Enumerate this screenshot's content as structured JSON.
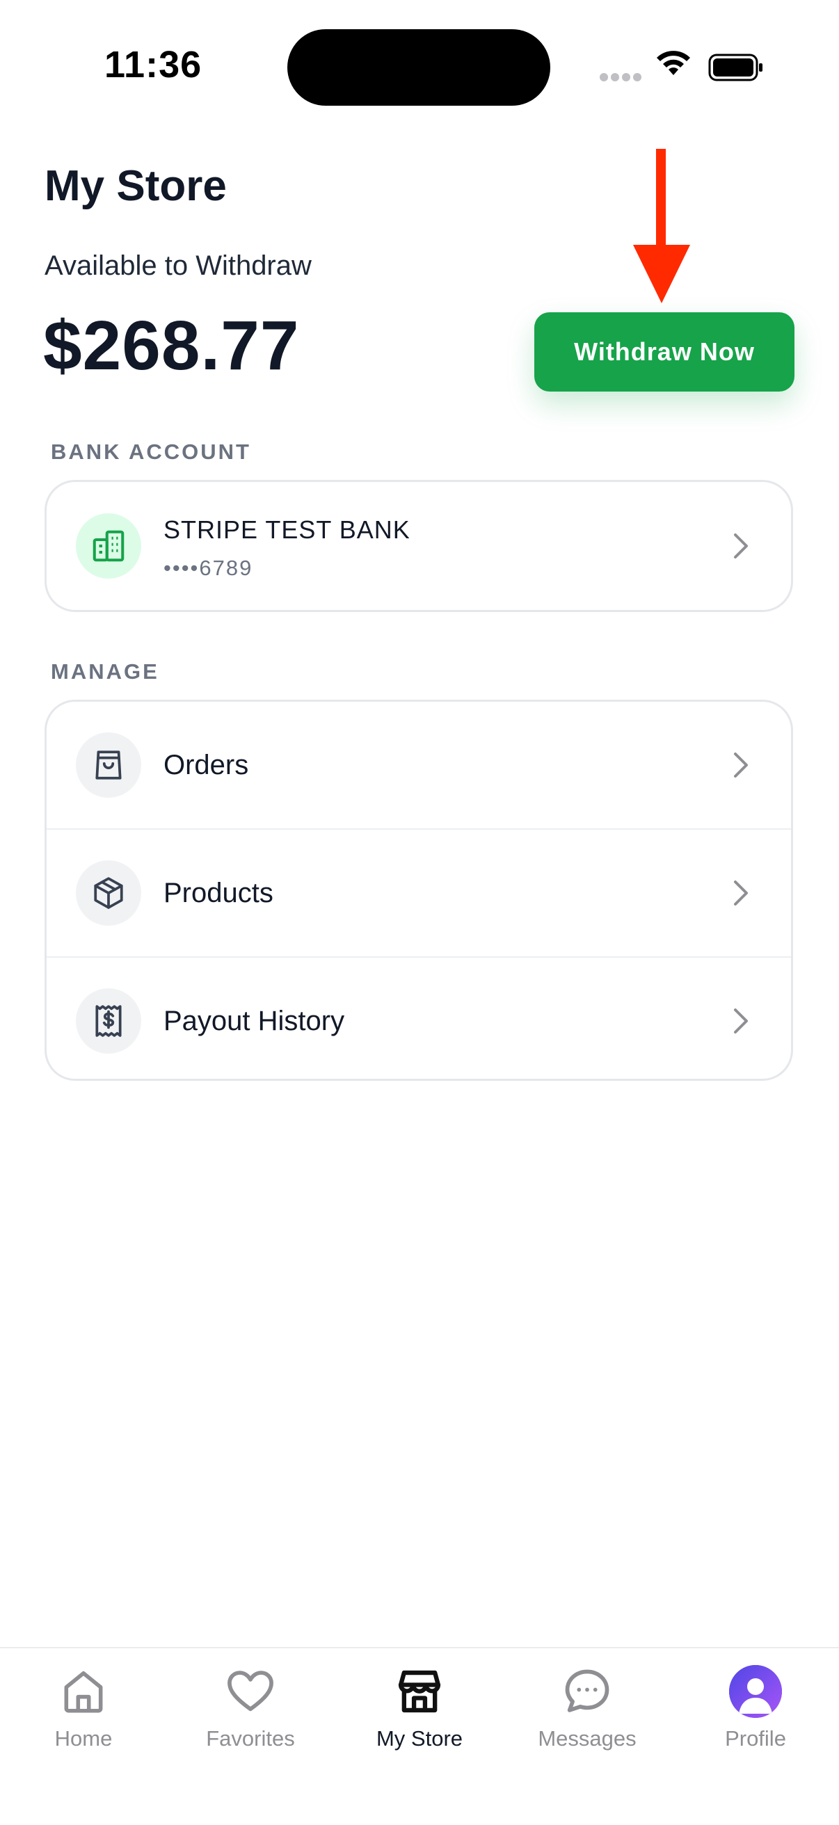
{
  "status_bar": {
    "time": "11:36"
  },
  "header": {
    "title": "My Store",
    "available_label": "Available to Withdraw",
    "balance": "$268.77"
  },
  "withdraw_button": {
    "label": "Withdraw Now",
    "color": "#16a34a"
  },
  "annotation": {
    "arrow_color": "#ff2a00"
  },
  "bank_section": {
    "label": "BANK ACCOUNT",
    "bank_name": "STRIPE TEST BANK",
    "account_masked": "••••6789",
    "icon": "bank-building-icon"
  },
  "manage_section": {
    "label": "MANAGE",
    "items": [
      {
        "label": "Orders",
        "icon": "shopping-bag-icon"
      },
      {
        "label": "Products",
        "icon": "box-icon"
      },
      {
        "label": "Payout History",
        "icon": "receipt-dollar-icon"
      }
    ]
  },
  "tabbar": {
    "tabs": [
      {
        "label": "Home",
        "icon": "home-icon"
      },
      {
        "label": "Favorites",
        "icon": "heart-icon"
      },
      {
        "label": "My Store",
        "icon": "store-icon",
        "active": true
      },
      {
        "label": "Messages",
        "icon": "chat-bubble-icon"
      },
      {
        "label": "Profile",
        "icon": "avatar"
      }
    ]
  }
}
